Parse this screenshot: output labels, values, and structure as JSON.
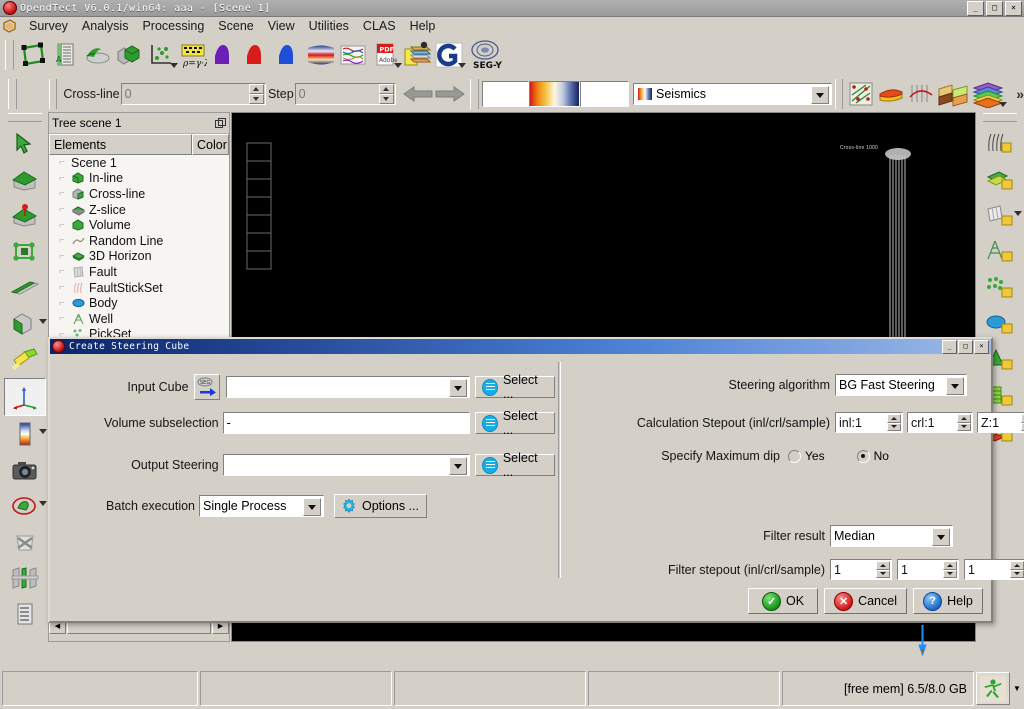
{
  "window": {
    "title": "OpendTect V6.0.1/win64: aaa - [Scene 1]",
    "minimize": "_",
    "maximize": "□",
    "close": "×",
    "restore_child": "⧉"
  },
  "menu": {
    "items": [
      {
        "label": "Survey"
      },
      {
        "label": "Analysis"
      },
      {
        "label": "Processing"
      },
      {
        "label": "Scene"
      },
      {
        "label": "View"
      },
      {
        "label": "Utilities"
      },
      {
        "label": "CLAS"
      },
      {
        "label": "Help"
      }
    ]
  },
  "toolbar_main": {
    "items": [
      {
        "name": "survey-setup-icon",
        "tip": "Survey setup"
      },
      {
        "name": "manage-seismics-icon",
        "tip": "Manage seismic data"
      },
      {
        "name": "attributes-icon",
        "tip": "Attributes"
      },
      {
        "name": "volume-builder-icon",
        "tip": "Volume builder"
      },
      {
        "name": "crossplot-icon",
        "tip": "Cross-plot data"
      },
      {
        "name": "rockphysics-icon",
        "tip": "Rock physics"
      },
      {
        "name": "wavelet-purple-icon",
        "tip": "Wavelet"
      },
      {
        "name": "wavelet-red-icon",
        "tip": "Wavelet"
      },
      {
        "name": "wavelet-blue-icon",
        "tip": "Wavelet"
      },
      {
        "name": "seismic-section-icon",
        "tip": "Seismic display"
      },
      {
        "name": "well-log-icon",
        "tip": "Well logs"
      },
      {
        "name": "pdf-export-icon",
        "tip": "PDF"
      },
      {
        "name": "layer-model-icon",
        "tip": "Layer modeling"
      },
      {
        "name": "opendtect-logo-icon",
        "tip": "OpendTect"
      },
      {
        "name": "segy-icon",
        "tip": "SEG-Y",
        "label": "SEG-Y"
      }
    ]
  },
  "toolbar_slice": {
    "crossline_label": "Cross-line",
    "crossline_value": "0",
    "step_label": "Step",
    "step_value": "0",
    "prev_tip": "Previous",
    "next_tip": "Next",
    "colortable_selected": "Seismics"
  },
  "toolbar_scene": {
    "items": [
      {
        "name": "random-line-grid-icon"
      },
      {
        "name": "horizon-icon"
      },
      {
        "name": "fault-icon"
      },
      {
        "name": "wedge-model-icon"
      },
      {
        "name": "stratigraphy-icon"
      }
    ],
    "overflow": "»"
  },
  "left_toolbar": {
    "items": [
      {
        "name": "pick-mode-icon"
      },
      {
        "name": "view-home-icon"
      },
      {
        "name": "set-home-icon"
      },
      {
        "name": "view-all-icon"
      },
      {
        "name": "view-inline-icon"
      },
      {
        "name": "display-orientation-icon",
        "has_menu": true
      },
      {
        "name": "highlight-marker-icon"
      },
      {
        "name": "axis-annotation-icon",
        "selected": true
      },
      {
        "name": "colorbar-icon",
        "has_menu": true
      },
      {
        "name": "snapshot-icon"
      },
      {
        "name": "polygon-selection-icon",
        "has_menu": true
      },
      {
        "name": "remove-selection-icon"
      },
      {
        "name": "soloview-icon"
      },
      {
        "name": "directional-light-icon"
      }
    ]
  },
  "right_toolbar": {
    "items": [
      {
        "name": "wells-tree-icon"
      },
      {
        "name": "horizons-tree-icon"
      },
      {
        "name": "faults-tree-icon"
      },
      {
        "name": "wells-manage-icon"
      },
      {
        "name": "picksets-tree-icon"
      },
      {
        "name": "bodies-tree-icon"
      },
      {
        "name": "crossplot-tree-icon"
      },
      {
        "name": "sessions-tree-icon"
      },
      {
        "name": "strat-tree-icon"
      }
    ]
  },
  "tree": {
    "panel_title": "Tree scene 1",
    "float_tip": "Undock",
    "columns": [
      "Elements",
      "Color"
    ],
    "items": [
      {
        "label": "Scene 1",
        "icon": "scene-icon"
      },
      {
        "label": "In-line",
        "icon": "inline-icon"
      },
      {
        "label": "Cross-line",
        "icon": "crossline-icon"
      },
      {
        "label": "Z-slice",
        "icon": "zslice-icon"
      },
      {
        "label": "Volume",
        "icon": "volume-icon"
      },
      {
        "label": "Random Line",
        "icon": "randomline-icon"
      },
      {
        "label": "3D Horizon",
        "icon": "horizon3d-icon"
      },
      {
        "label": "Fault",
        "icon": "fault-icon"
      },
      {
        "label": "FaultStickSet",
        "icon": "faultstickset-icon"
      },
      {
        "label": "Body",
        "icon": "body-icon"
      },
      {
        "label": "Well",
        "icon": "well-icon"
      },
      {
        "label": "PickSet",
        "icon": "pickset-icon"
      }
    ],
    "scroll_left": "◀",
    "scroll_right": "▶"
  },
  "scene": {
    "annotation": "Cross-line 1000"
  },
  "dialog": {
    "title": "Create Steering Cube",
    "minimize": "_",
    "maximize": "□",
    "close": "×",
    "left": {
      "input_cube_label": "Input Cube",
      "input_cube_value": "",
      "input_cube_icon": "segy-arrow-icon",
      "volume_subsel_label": "Volume subselection",
      "volume_subsel_value": "-",
      "output_steering_label": "Output Steering",
      "output_steering_value": "",
      "batch_label": "Batch execution",
      "batch_value": "Single Process",
      "options_label": "Options ...",
      "options_icon": "gear-icon",
      "select_label": "Select ..."
    },
    "right": {
      "algorithm_label": "Steering algorithm",
      "algorithm_value": "BG Fast Steering",
      "calc_stepout_label": "Calculation Stepout (inl/crl/sample)",
      "calc_inl": "inl:1",
      "calc_crl": "crl:1",
      "calc_z": "Z:1",
      "maxdip_label": "Specify Maximum dip",
      "maxdip_yes": "Yes",
      "maxdip_no": "No",
      "maxdip_selected": "No",
      "filter_result_label": "Filter result",
      "filter_result_value": "Median",
      "filter_stepout_label": "Filter stepout (inl/crl/sample)",
      "filter_inl": "1",
      "filter_crl": "1",
      "filter_z": "1"
    },
    "buttons": {
      "ok": "OK",
      "cancel": "Cancel",
      "help": "Help",
      "ok_icon": "check-circle-icon",
      "cancel_icon": "x-circle-icon",
      "help_icon": "question-circle-icon"
    }
  },
  "statusbar": {
    "cells": [
      "",
      "",
      "",
      ""
    ],
    "memory": "[free mem] 6.5/8.0 GB",
    "run_icon": "running-man-icon",
    "menu_caret": "▼"
  },
  "colors": {
    "face": "#d4d0c8",
    "title_blue": "#0a246a",
    "accent_cyan": "#19aee3",
    "scene_bg": "#000000"
  }
}
